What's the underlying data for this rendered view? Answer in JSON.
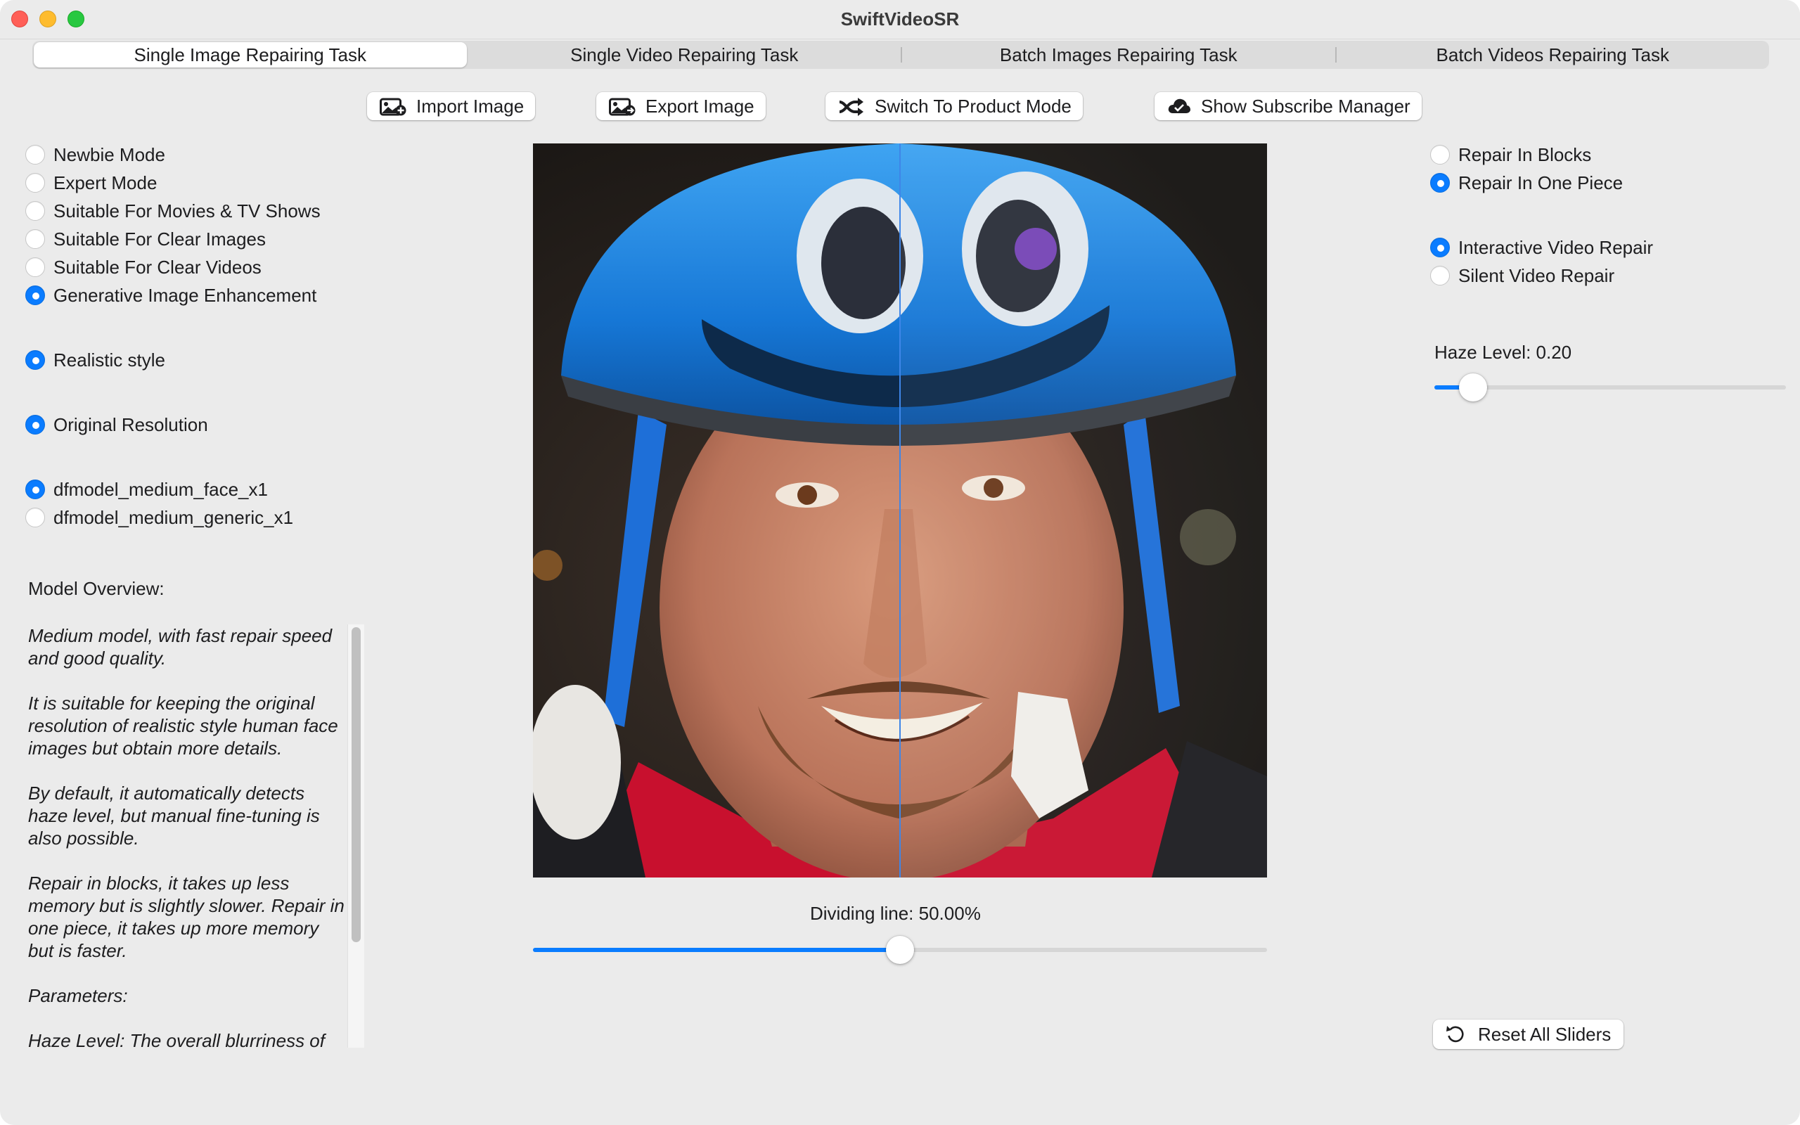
{
  "window": {
    "title": "SwiftVideoSR"
  },
  "tabs": [
    {
      "label": "Single Image Repairing Task",
      "active": true
    },
    {
      "label": "Single Video Repairing Task",
      "active": false
    },
    {
      "label": "Batch Images Repairing Task",
      "active": false
    },
    {
      "label": "Batch Videos Repairing Task",
      "active": false
    }
  ],
  "toolbar": {
    "import_label": "Import Image",
    "export_label": "Export Image",
    "switch_label": "Switch To Product Mode",
    "subscribe_label": "Show Subscribe Manager"
  },
  "mode_options": [
    {
      "label": "Newbie Mode",
      "selected": false
    },
    {
      "label": "Expert Mode",
      "selected": false
    },
    {
      "label": "Suitable For Movies & TV Shows",
      "selected": false
    },
    {
      "label": "Suitable For Clear Images",
      "selected": false
    },
    {
      "label": "Suitable For Clear Videos",
      "selected": false
    },
    {
      "label": "Generative Image Enhancement",
      "selected": true
    }
  ],
  "style_option": {
    "label": "Realistic style",
    "selected": true
  },
  "resolution_option": {
    "label": "Original Resolution",
    "selected": true
  },
  "model_options": [
    {
      "label": "dfmodel_medium_face_x1",
      "selected": true
    },
    {
      "label": "dfmodel_medium_generic_x1",
      "selected": false
    }
  ],
  "overview": {
    "label": "Model Overview:",
    "paragraphs": [
      "Medium model, with fast repair speed and good quality.",
      "It is suitable for keeping the original resolution of realistic style human face images but obtain more details.",
      "By default, it automatically detects haze level, but manual fine-tuning is also possible.",
      "Repair in blocks, it takes up less memory but is slightly slower. Repair in one piece, it takes up more memory but is faster.",
      "Parameters:",
      "Haze Level: The overall blurriness of"
    ]
  },
  "repair_options": [
    {
      "label": "Repair In Blocks",
      "selected": false
    },
    {
      "label": "Repair In One Piece",
      "selected": true
    }
  ],
  "video_options": [
    {
      "label": "Interactive Video Repair",
      "selected": true
    },
    {
      "label": "Silent Video Repair",
      "selected": false
    }
  ],
  "haze": {
    "label": "Haze Level: 0.20",
    "value": 0.2
  },
  "dividing": {
    "label": "Dividing line: 50.00%",
    "value": 0.5
  },
  "reset_label": "Reset All Sliders",
  "colors": {
    "accent": "#0a7cff",
    "divider": "#3e86e8"
  }
}
